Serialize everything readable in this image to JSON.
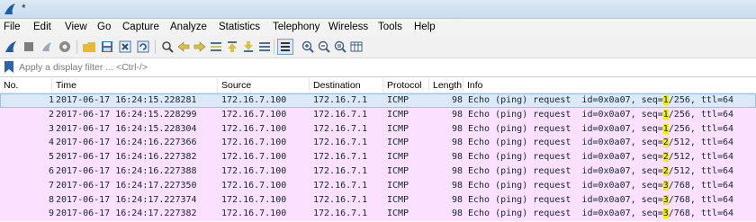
{
  "window": {
    "title": "*"
  },
  "menu": [
    "File",
    "Edit",
    "View",
    "Go",
    "Capture",
    "Analyze",
    "Statistics",
    "Telephony",
    "Wireless",
    "Tools",
    "Help"
  ],
  "filter": {
    "placeholder": "Apply a display filter ... <Ctrl-/>"
  },
  "toolbar_icons": [
    "shark-fin-start-icon",
    "stop-icon",
    "restart-icon",
    "options-gear-icon",
    "open-folder-icon",
    "save-icon",
    "close-file-icon",
    "reload-icon",
    "find-icon",
    "go-back-icon",
    "go-forward-icon",
    "go-to-packet-icon",
    "go-first-icon",
    "go-last-icon",
    "auto-scroll-icon",
    "colorize-icon",
    "zoom-in-icon",
    "zoom-out-icon",
    "zoom-normal-icon",
    "resize-columns-icon"
  ],
  "columns": [
    "No.",
    "Time",
    "Source",
    "Destination",
    "Protocol",
    "Length",
    "Info"
  ],
  "packets": [
    {
      "no": "1",
      "time": "2017-06-17 16:24:15.228281",
      "src": "172.16.7.100",
      "dst": "172.16.7.1",
      "proto": "ICMP",
      "len": "98",
      "info_a": "Echo (ping) request  id=0x0a07, seq=",
      "seq": "1",
      "info_b": "/256, ttl=64",
      "selected": true
    },
    {
      "no": "2",
      "time": "2017-06-17 16:24:15.228299",
      "src": "172.16.7.100",
      "dst": "172.16.7.1",
      "proto": "ICMP",
      "len": "98",
      "info_a": "Echo (ping) request  id=0x0a07, seq=",
      "seq": "1",
      "info_b": "/256, ttl=64",
      "selected": false
    },
    {
      "no": "3",
      "time": "2017-06-17 16:24:15.228304",
      "src": "172.16.7.100",
      "dst": "172.16.7.1",
      "proto": "ICMP",
      "len": "98",
      "info_a": "Echo (ping) request  id=0x0a07, seq=",
      "seq": "1",
      "info_b": "/256, ttl=64",
      "selected": false
    },
    {
      "no": "4",
      "time": "2017-06-17 16:24:16.227366",
      "src": "172.16.7.100",
      "dst": "172.16.7.1",
      "proto": "ICMP",
      "len": "98",
      "info_a": "Echo (ping) request  id=0x0a07, seq=",
      "seq": "2",
      "info_b": "/512, ttl=64",
      "selected": false
    },
    {
      "no": "5",
      "time": "2017-06-17 16:24:16.227382",
      "src": "172.16.7.100",
      "dst": "172.16.7.1",
      "proto": "ICMP",
      "len": "98",
      "info_a": "Echo (ping) request  id=0x0a07, seq=",
      "seq": "2",
      "info_b": "/512, ttl=64",
      "selected": false
    },
    {
      "no": "6",
      "time": "2017-06-17 16:24:16.227388",
      "src": "172.16.7.100",
      "dst": "172.16.7.1",
      "proto": "ICMP",
      "len": "98",
      "info_a": "Echo (ping) request  id=0x0a07, seq=",
      "seq": "2",
      "info_b": "/512, ttl=64",
      "selected": false
    },
    {
      "no": "7",
      "time": "2017-06-17 16:24:17.227350",
      "src": "172.16.7.100",
      "dst": "172.16.7.1",
      "proto": "ICMP",
      "len": "98",
      "info_a": "Echo (ping) request  id=0x0a07, seq=",
      "seq": "3",
      "info_b": "/768, ttl=64",
      "selected": false
    },
    {
      "no": "8",
      "time": "2017-06-17 16:24:17.227374",
      "src": "172.16.7.100",
      "dst": "172.16.7.1",
      "proto": "ICMP",
      "len": "98",
      "info_a": "Echo (ping) request  id=0x0a07, seq=",
      "seq": "3",
      "info_b": "/768, ttl=64",
      "selected": false
    },
    {
      "no": "9",
      "time": "2017-06-17 16:24:17.227382",
      "src": "172.16.7.100",
      "dst": "172.16.7.1",
      "proto": "ICMP",
      "len": "98",
      "info_a": "Echo (ping) request  id=0x0a07, seq=",
      "seq": "3",
      "info_b": "/768, ttl=64",
      "selected": false
    }
  ],
  "colors": {
    "icmp_row": "#fce0ff",
    "selected_row": "#dbe9fa",
    "seq_highlight": "#f5ec00",
    "row_text": "#12272e"
  }
}
